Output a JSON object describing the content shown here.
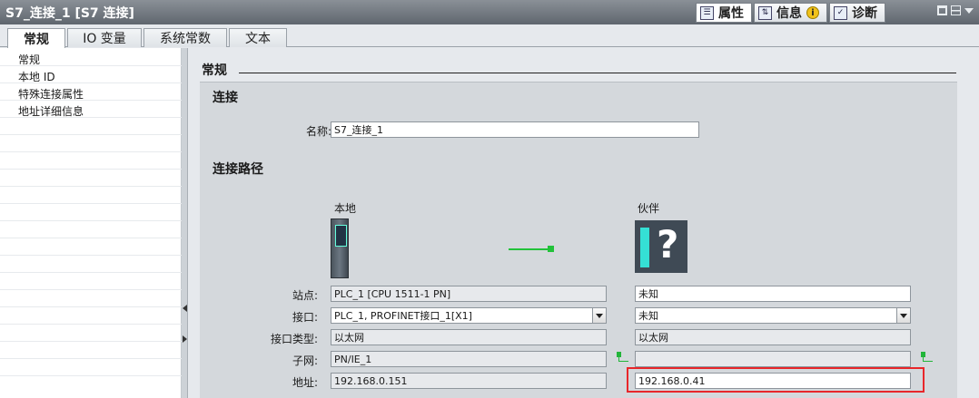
{
  "window": {
    "title": "S7_连接_1 [S7 连接]"
  },
  "panel_tabs": [
    {
      "label": "属性",
      "icon": "properties-icon"
    },
    {
      "label": "信息",
      "icon": "info-icon"
    },
    {
      "label": "诊断",
      "icon": "diagnostics-icon"
    }
  ],
  "tabs": [
    "常规",
    "IO 变量",
    "系统常数",
    "文本"
  ],
  "nav": [
    "常规",
    "本地 ID",
    "特殊连接属性",
    "地址详细信息"
  ],
  "main": {
    "section_title": "常规",
    "connection_title": "连接",
    "name_label": "名称:",
    "name_value": "S7_连接_1",
    "path_title": "连接路径",
    "local_header": "本地",
    "partner_header": "伙伴",
    "rows": {
      "station": {
        "label": "站点:",
        "local": "PLC_1 [CPU 1511-1 PN]",
        "partner": "未知"
      },
      "interface": {
        "label": "接口:",
        "local": "PLC_1, PROFINET接口_1[X1]",
        "partner": "未知"
      },
      "interface_type": {
        "label": "接口类型:",
        "local": "以太网",
        "partner": "以太网"
      },
      "subnet": {
        "label": "子网:",
        "local": "PN/IE_1",
        "partner": ""
      },
      "address": {
        "label": "地址:",
        "local": "192.168.0.151",
        "partner": "192.168.0.41"
      }
    }
  },
  "colors": {
    "highlight": "#e8262a",
    "link": "#22c23a",
    "titlebar": "#6f767e"
  }
}
